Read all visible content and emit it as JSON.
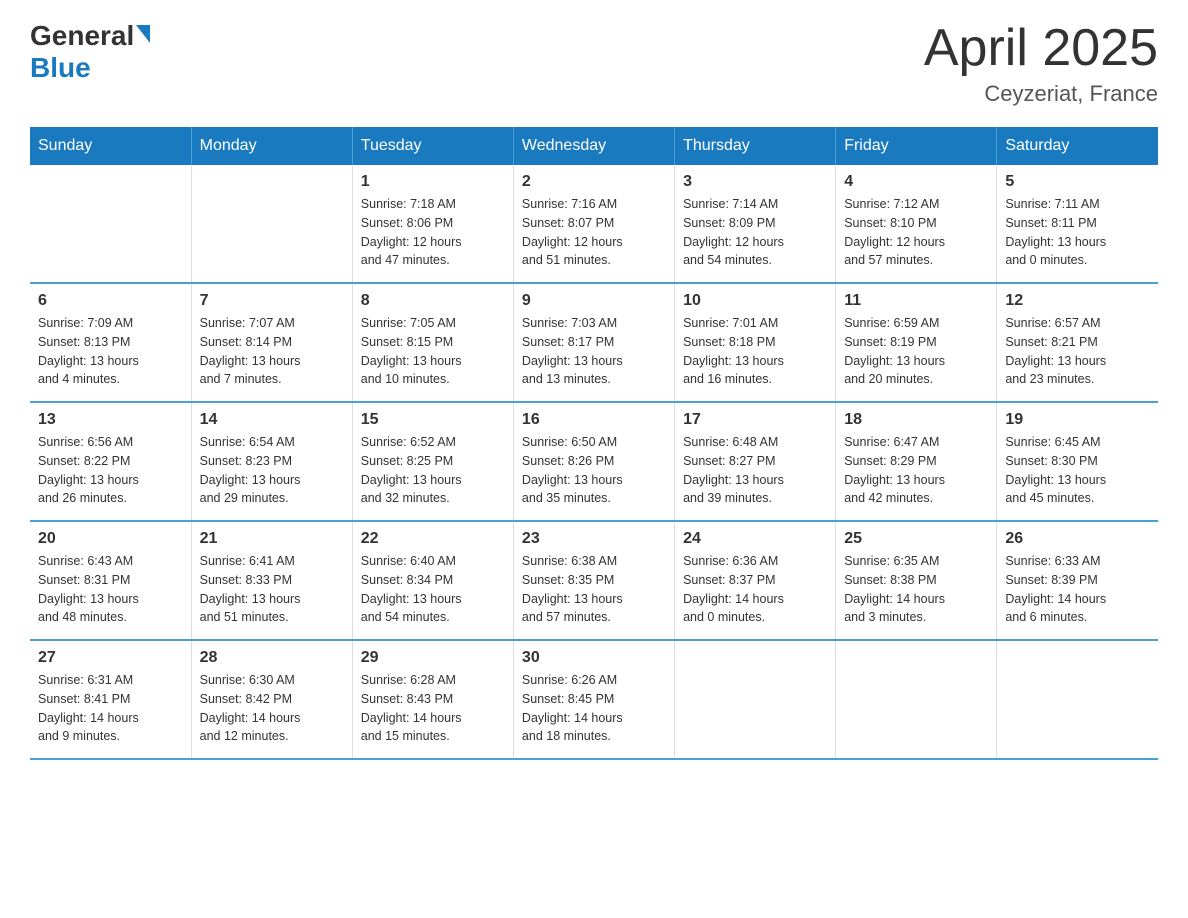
{
  "logo": {
    "general": "General",
    "blue": "Blue"
  },
  "header": {
    "title": "April 2025",
    "location": "Ceyzeriat, France"
  },
  "weekdays": [
    "Sunday",
    "Monday",
    "Tuesday",
    "Wednesday",
    "Thursday",
    "Friday",
    "Saturday"
  ],
  "weeks": [
    [
      {
        "day": "",
        "info": ""
      },
      {
        "day": "",
        "info": ""
      },
      {
        "day": "1",
        "info": "Sunrise: 7:18 AM\nSunset: 8:06 PM\nDaylight: 12 hours\nand 47 minutes."
      },
      {
        "day": "2",
        "info": "Sunrise: 7:16 AM\nSunset: 8:07 PM\nDaylight: 12 hours\nand 51 minutes."
      },
      {
        "day": "3",
        "info": "Sunrise: 7:14 AM\nSunset: 8:09 PM\nDaylight: 12 hours\nand 54 minutes."
      },
      {
        "day": "4",
        "info": "Sunrise: 7:12 AM\nSunset: 8:10 PM\nDaylight: 12 hours\nand 57 minutes."
      },
      {
        "day": "5",
        "info": "Sunrise: 7:11 AM\nSunset: 8:11 PM\nDaylight: 13 hours\nand 0 minutes."
      }
    ],
    [
      {
        "day": "6",
        "info": "Sunrise: 7:09 AM\nSunset: 8:13 PM\nDaylight: 13 hours\nand 4 minutes."
      },
      {
        "day": "7",
        "info": "Sunrise: 7:07 AM\nSunset: 8:14 PM\nDaylight: 13 hours\nand 7 minutes."
      },
      {
        "day": "8",
        "info": "Sunrise: 7:05 AM\nSunset: 8:15 PM\nDaylight: 13 hours\nand 10 minutes."
      },
      {
        "day": "9",
        "info": "Sunrise: 7:03 AM\nSunset: 8:17 PM\nDaylight: 13 hours\nand 13 minutes."
      },
      {
        "day": "10",
        "info": "Sunrise: 7:01 AM\nSunset: 8:18 PM\nDaylight: 13 hours\nand 16 minutes."
      },
      {
        "day": "11",
        "info": "Sunrise: 6:59 AM\nSunset: 8:19 PM\nDaylight: 13 hours\nand 20 minutes."
      },
      {
        "day": "12",
        "info": "Sunrise: 6:57 AM\nSunset: 8:21 PM\nDaylight: 13 hours\nand 23 minutes."
      }
    ],
    [
      {
        "day": "13",
        "info": "Sunrise: 6:56 AM\nSunset: 8:22 PM\nDaylight: 13 hours\nand 26 minutes."
      },
      {
        "day": "14",
        "info": "Sunrise: 6:54 AM\nSunset: 8:23 PM\nDaylight: 13 hours\nand 29 minutes."
      },
      {
        "day": "15",
        "info": "Sunrise: 6:52 AM\nSunset: 8:25 PM\nDaylight: 13 hours\nand 32 minutes."
      },
      {
        "day": "16",
        "info": "Sunrise: 6:50 AM\nSunset: 8:26 PM\nDaylight: 13 hours\nand 35 minutes."
      },
      {
        "day": "17",
        "info": "Sunrise: 6:48 AM\nSunset: 8:27 PM\nDaylight: 13 hours\nand 39 minutes."
      },
      {
        "day": "18",
        "info": "Sunrise: 6:47 AM\nSunset: 8:29 PM\nDaylight: 13 hours\nand 42 minutes."
      },
      {
        "day": "19",
        "info": "Sunrise: 6:45 AM\nSunset: 8:30 PM\nDaylight: 13 hours\nand 45 minutes."
      }
    ],
    [
      {
        "day": "20",
        "info": "Sunrise: 6:43 AM\nSunset: 8:31 PM\nDaylight: 13 hours\nand 48 minutes."
      },
      {
        "day": "21",
        "info": "Sunrise: 6:41 AM\nSunset: 8:33 PM\nDaylight: 13 hours\nand 51 minutes."
      },
      {
        "day": "22",
        "info": "Sunrise: 6:40 AM\nSunset: 8:34 PM\nDaylight: 13 hours\nand 54 minutes."
      },
      {
        "day": "23",
        "info": "Sunrise: 6:38 AM\nSunset: 8:35 PM\nDaylight: 13 hours\nand 57 minutes."
      },
      {
        "day": "24",
        "info": "Sunrise: 6:36 AM\nSunset: 8:37 PM\nDaylight: 14 hours\nand 0 minutes."
      },
      {
        "day": "25",
        "info": "Sunrise: 6:35 AM\nSunset: 8:38 PM\nDaylight: 14 hours\nand 3 minutes."
      },
      {
        "day": "26",
        "info": "Sunrise: 6:33 AM\nSunset: 8:39 PM\nDaylight: 14 hours\nand 6 minutes."
      }
    ],
    [
      {
        "day": "27",
        "info": "Sunrise: 6:31 AM\nSunset: 8:41 PM\nDaylight: 14 hours\nand 9 minutes."
      },
      {
        "day": "28",
        "info": "Sunrise: 6:30 AM\nSunset: 8:42 PM\nDaylight: 14 hours\nand 12 minutes."
      },
      {
        "day": "29",
        "info": "Sunrise: 6:28 AM\nSunset: 8:43 PM\nDaylight: 14 hours\nand 15 minutes."
      },
      {
        "day": "30",
        "info": "Sunrise: 6:26 AM\nSunset: 8:45 PM\nDaylight: 14 hours\nand 18 minutes."
      },
      {
        "day": "",
        "info": ""
      },
      {
        "day": "",
        "info": ""
      },
      {
        "day": "",
        "info": ""
      }
    ]
  ]
}
